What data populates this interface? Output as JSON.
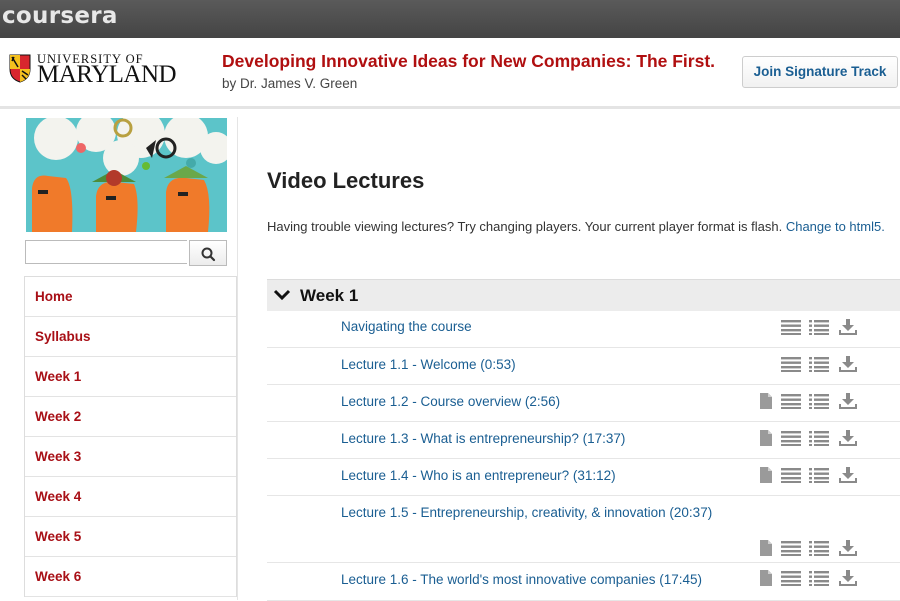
{
  "brand": "coursera",
  "university": {
    "line1": "UNIVERSITY OF",
    "line2": "MARYLAND"
  },
  "course": {
    "title": "Developing Innovative Ideas for New Companies: The First.",
    "byline": "by Dr. James V. Green"
  },
  "join_button": "Join Signature Track",
  "search": {
    "placeholder": "",
    "value": ""
  },
  "nav": [
    "Home",
    "Syllabus",
    "Week 1",
    "Week 2",
    "Week 3",
    "Week 4",
    "Week 5",
    "Week 6"
  ],
  "main": {
    "title": "Video Lectures",
    "notice": "Having trouble viewing lectures? Try changing players. Your current player format is flash.",
    "notice_link": "Change to html5."
  },
  "week": {
    "label": "Week 1"
  },
  "lectures": [
    {
      "title": "Navigating the course",
      "icons": [
        "lines-icon",
        "list-icon",
        "download-icon"
      ]
    },
    {
      "title": "Lecture 1.1 - Welcome (0:53)",
      "icons": [
        "lines-icon",
        "list-icon",
        "download-icon"
      ]
    },
    {
      "title": "Lecture 1.2 - Course overview (2:56)",
      "icons": [
        "document-icon",
        "lines-icon",
        "list-icon",
        "download-icon"
      ]
    },
    {
      "title": "Lecture 1.3 - What is entrepreneurship? (17:37)",
      "icons": [
        "document-icon",
        "lines-icon",
        "list-icon",
        "download-icon"
      ]
    },
    {
      "title": "Lecture 1.4 - Who is an entrepreneur? (31:12)",
      "icons": [
        "document-icon",
        "lines-icon",
        "list-icon",
        "download-icon"
      ]
    },
    {
      "title": "Lecture 1.5 - Entrepreneurship, creativity, & innovation (20:37)",
      "icons": [
        "document-icon",
        "lines-icon",
        "list-icon",
        "download-icon"
      ]
    },
    {
      "title": "Lecture 1.6 - The world's most innovative companies (17:45)",
      "icons": [
        "document-icon",
        "lines-icon",
        "list-icon",
        "download-icon"
      ]
    }
  ],
  "colors": {
    "nav_text": "#a80f16",
    "link": "#1a5e92",
    "title_red": "#b00f10",
    "topbar": "#4a4a4a"
  }
}
